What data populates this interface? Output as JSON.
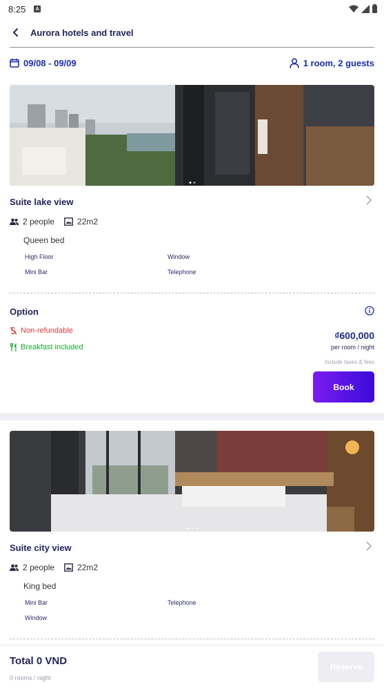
{
  "status_bar": {
    "time": "8:25",
    "notification_glyph": "A"
  },
  "header": {
    "title": "Aurora hotels and travel"
  },
  "search": {
    "dates": "09/08 - 09/09",
    "guests": "1 room, 2 guests"
  },
  "rooms": [
    {
      "name": "Suite lake view",
      "people": "2 people",
      "area": "22m2",
      "bed": "Queen bed",
      "amenities": [
        "High Floor",
        "Window",
        "Mini Bar",
        "Telephone"
      ]
    },
    {
      "name": "Suite city view",
      "people": "2 people",
      "area": "22m2",
      "bed": "King bed",
      "amenities": [
        "Mini Bar",
        "Telephone",
        "Window"
      ]
    }
  ],
  "option": {
    "title": "Option",
    "refund_policy": "Non-refundable",
    "breakfast": "Breakfast included",
    "price": "₫600,000",
    "price_unit": "per room / night",
    "taxes_note": "Include taxes & fees",
    "book_label": "Book"
  },
  "footer": {
    "total": "Total 0 VND",
    "sub": "0 rooms / night",
    "reserve_label": "Reserve"
  },
  "colors": {
    "primary": "#1b2bb8",
    "button_gradient_start": "#7a1df0",
    "button_gradient_end": "#3b0bd9",
    "refund_red": "#e0393e",
    "breakfast_green": "#18a92c"
  },
  "icons": [
    "back-arrow-icon",
    "calendar-icon",
    "person-icon",
    "chevron-right-icon",
    "people-icon",
    "area-icon",
    "info-icon",
    "no-refund-icon",
    "fork-knife-icon",
    "wifi-icon",
    "signal-icon",
    "battery-icon"
  ]
}
